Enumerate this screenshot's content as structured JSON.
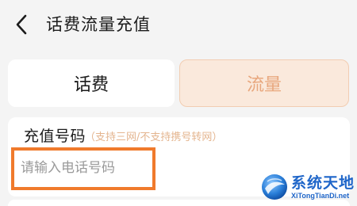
{
  "header": {
    "title": "话费流量充值",
    "back_icon": "chevron-left-icon"
  },
  "tabs": [
    {
      "label": "话费",
      "selected": false
    },
    {
      "label": "流量",
      "selected": true
    }
  ],
  "form": {
    "field_label": "充值号码",
    "field_hint": "（支持三网/不支持携号转网）",
    "phone_placeholder": "请输入电话号码",
    "phone_value": ""
  },
  "watermark": {
    "cn_text": "系统天地",
    "en_text": "XiTongTianDi.net"
  },
  "colors": {
    "accent": "#f07a2c",
    "tab_selected_bg": "#fae9dc",
    "tab_selected_text": "#e8a77d",
    "hint_text": "#e4b58f",
    "watermark_blue": "#1f66c9"
  }
}
